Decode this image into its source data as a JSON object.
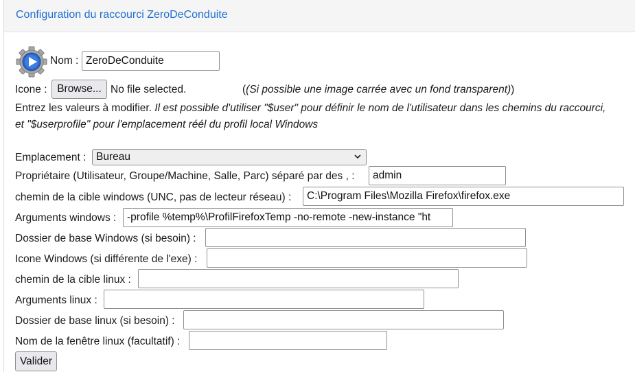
{
  "header": {
    "title": "Configuration du raccourci ZeroDeConduite"
  },
  "form": {
    "name_label": "Nom :",
    "name_value": "ZeroDeConduite",
    "icon_label": "Icone :",
    "browse_label": "Browse...",
    "file_status": "No file selected.",
    "icon_hint": "(Si possible une image carrée avec un fond transparent)",
    "instructions_plain": "Entrez les valeurs à modifier.",
    "instructions_italic_1": "Il est possible d'utiliser \"$user\" pour définir le nom de l'utilisateur dans les chemins du raccourci,",
    "instructions_italic_2": "et \"$userprofile\" pour l'emplacement réél du profil local Windows",
    "location_label": "Emplacement :",
    "location_value": "Bureau",
    "owner_label": "Propriétaire (Utilisateur, Groupe/Machine, Salle, Parc) séparé par des , :",
    "owner_value": "admin",
    "win_target_label": "chemin de la cible windows (UNC, pas de lecteur réseau) :",
    "win_target_value": "C:\\Program Files\\Mozilla Firefox\\firefox.exe",
    "win_args_label": "Arguments windows :",
    "win_args_value": "-profile %temp%\\ProfilFirefoxTemp -no-remote -new-instance \"ht",
    "win_dir_label": "Dossier de base Windows (si besoin) :",
    "win_dir_value": "",
    "win_icon_label": "Icone Windows (si différente de l'exe) :",
    "win_icon_value": "",
    "linux_target_label": "chemin de la cible linux :",
    "linux_target_value": "",
    "linux_args_label": "Arguments linux :",
    "linux_args_value": "",
    "linux_dir_label": "Dossier de base linux (si besoin) :",
    "linux_dir_value": "",
    "linux_window_label": "Nom de la fenêtre linux (facultatif) :",
    "linux_window_value": "",
    "submit_label": "Valider"
  },
  "colors": {
    "title": "#1f6fd1",
    "icon_play": "#2a66c9"
  },
  "icons": {
    "shortcut": "gear-play-icon",
    "dropdown": "chevron-down-icon"
  }
}
